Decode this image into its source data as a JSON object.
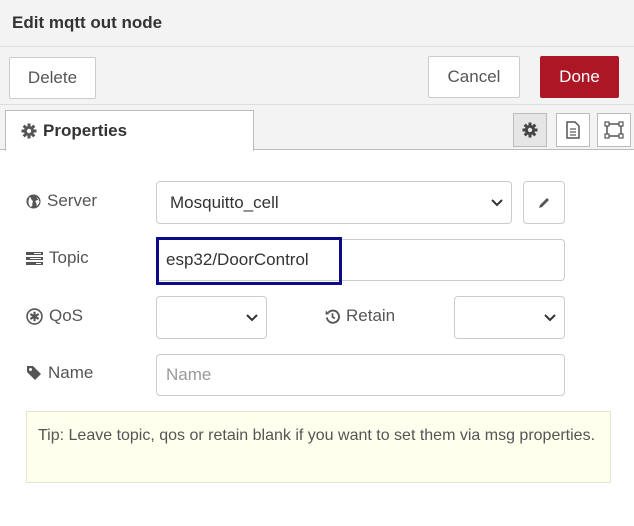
{
  "dialog": {
    "title": "Edit mqtt out node"
  },
  "actions": {
    "delete_label": "Delete",
    "cancel_label": "Cancel",
    "done_label": "Done"
  },
  "tabs": {
    "properties_label": "Properties"
  },
  "form": {
    "server": {
      "label": "Server",
      "value": "Mosquitto_cell"
    },
    "topic": {
      "label": "Topic",
      "value": "esp32/DoorControl"
    },
    "qos": {
      "label": "QoS",
      "value": ""
    },
    "retain": {
      "label": "Retain",
      "value": ""
    },
    "name": {
      "label": "Name",
      "placeholder": "Name"
    }
  },
  "tip": {
    "text": "Tip: Leave topic, qos or retain blank if you want to set them via msg properties."
  },
  "colors": {
    "primary": "#ad1625",
    "focus": "#0b0b8a",
    "tip_bg": "#ffffee"
  },
  "icons": [
    "gear-icon",
    "document-icon",
    "frame-icon",
    "globe-icon",
    "tasks-icon",
    "asterisk-icon",
    "history-icon",
    "tag-icon",
    "pencil-icon",
    "chevron-down-icon"
  ]
}
